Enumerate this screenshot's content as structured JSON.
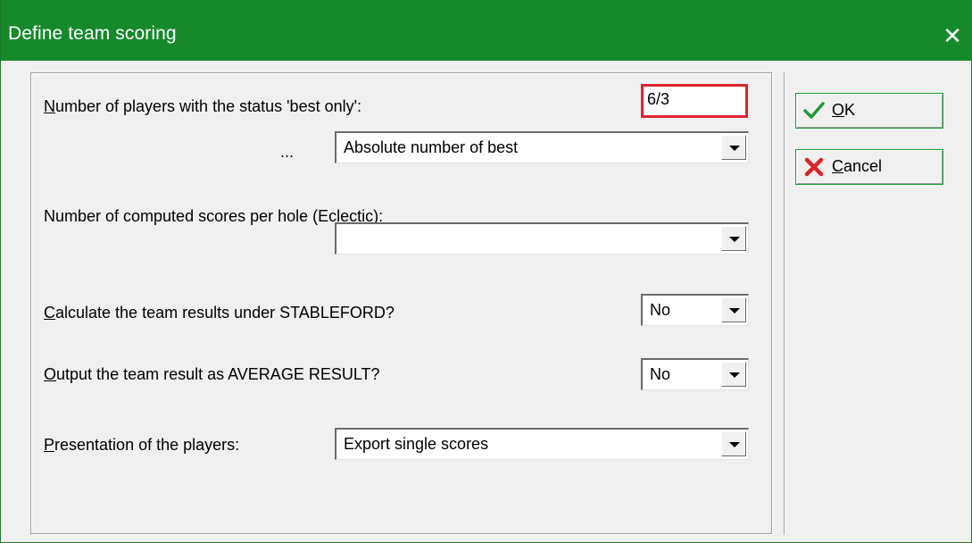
{
  "window": {
    "title": "Define team scoring",
    "close_glyph": "✕"
  },
  "form": {
    "best_only_label_key": "N",
    "best_only_label_rest": "umber of players with the status 'best only':",
    "best_only_value": "6/3",
    "ellipsis": "...",
    "best_mode_value": "Absolute number of best",
    "eclectic_label": "Number of computed scores per hole (Eclectic):",
    "eclectic_value": "",
    "stableford_label_key": "C",
    "stableford_label_rest": "alculate the team results under STABLEFORD?",
    "stableford_value": "No",
    "average_label_key": "O",
    "average_label_rest": "utput the team result as AVERAGE RESULT?",
    "average_value": "No",
    "presentation_label_key": "P",
    "presentation_label_rest": "resentation of the players:",
    "presentation_value": "Export single scores"
  },
  "buttons": {
    "ok_key": "O",
    "ok_rest": "K",
    "cancel_key": "C",
    "cancel_rest": "ancel",
    "ok_icon": "check-icon",
    "cancel_icon": "x-icon"
  },
  "colors": {
    "titlebar": "#168a2a",
    "highlight_border": "#e0232e",
    "check_green": "#1f9a3a",
    "cancel_red": "#d9262c"
  }
}
